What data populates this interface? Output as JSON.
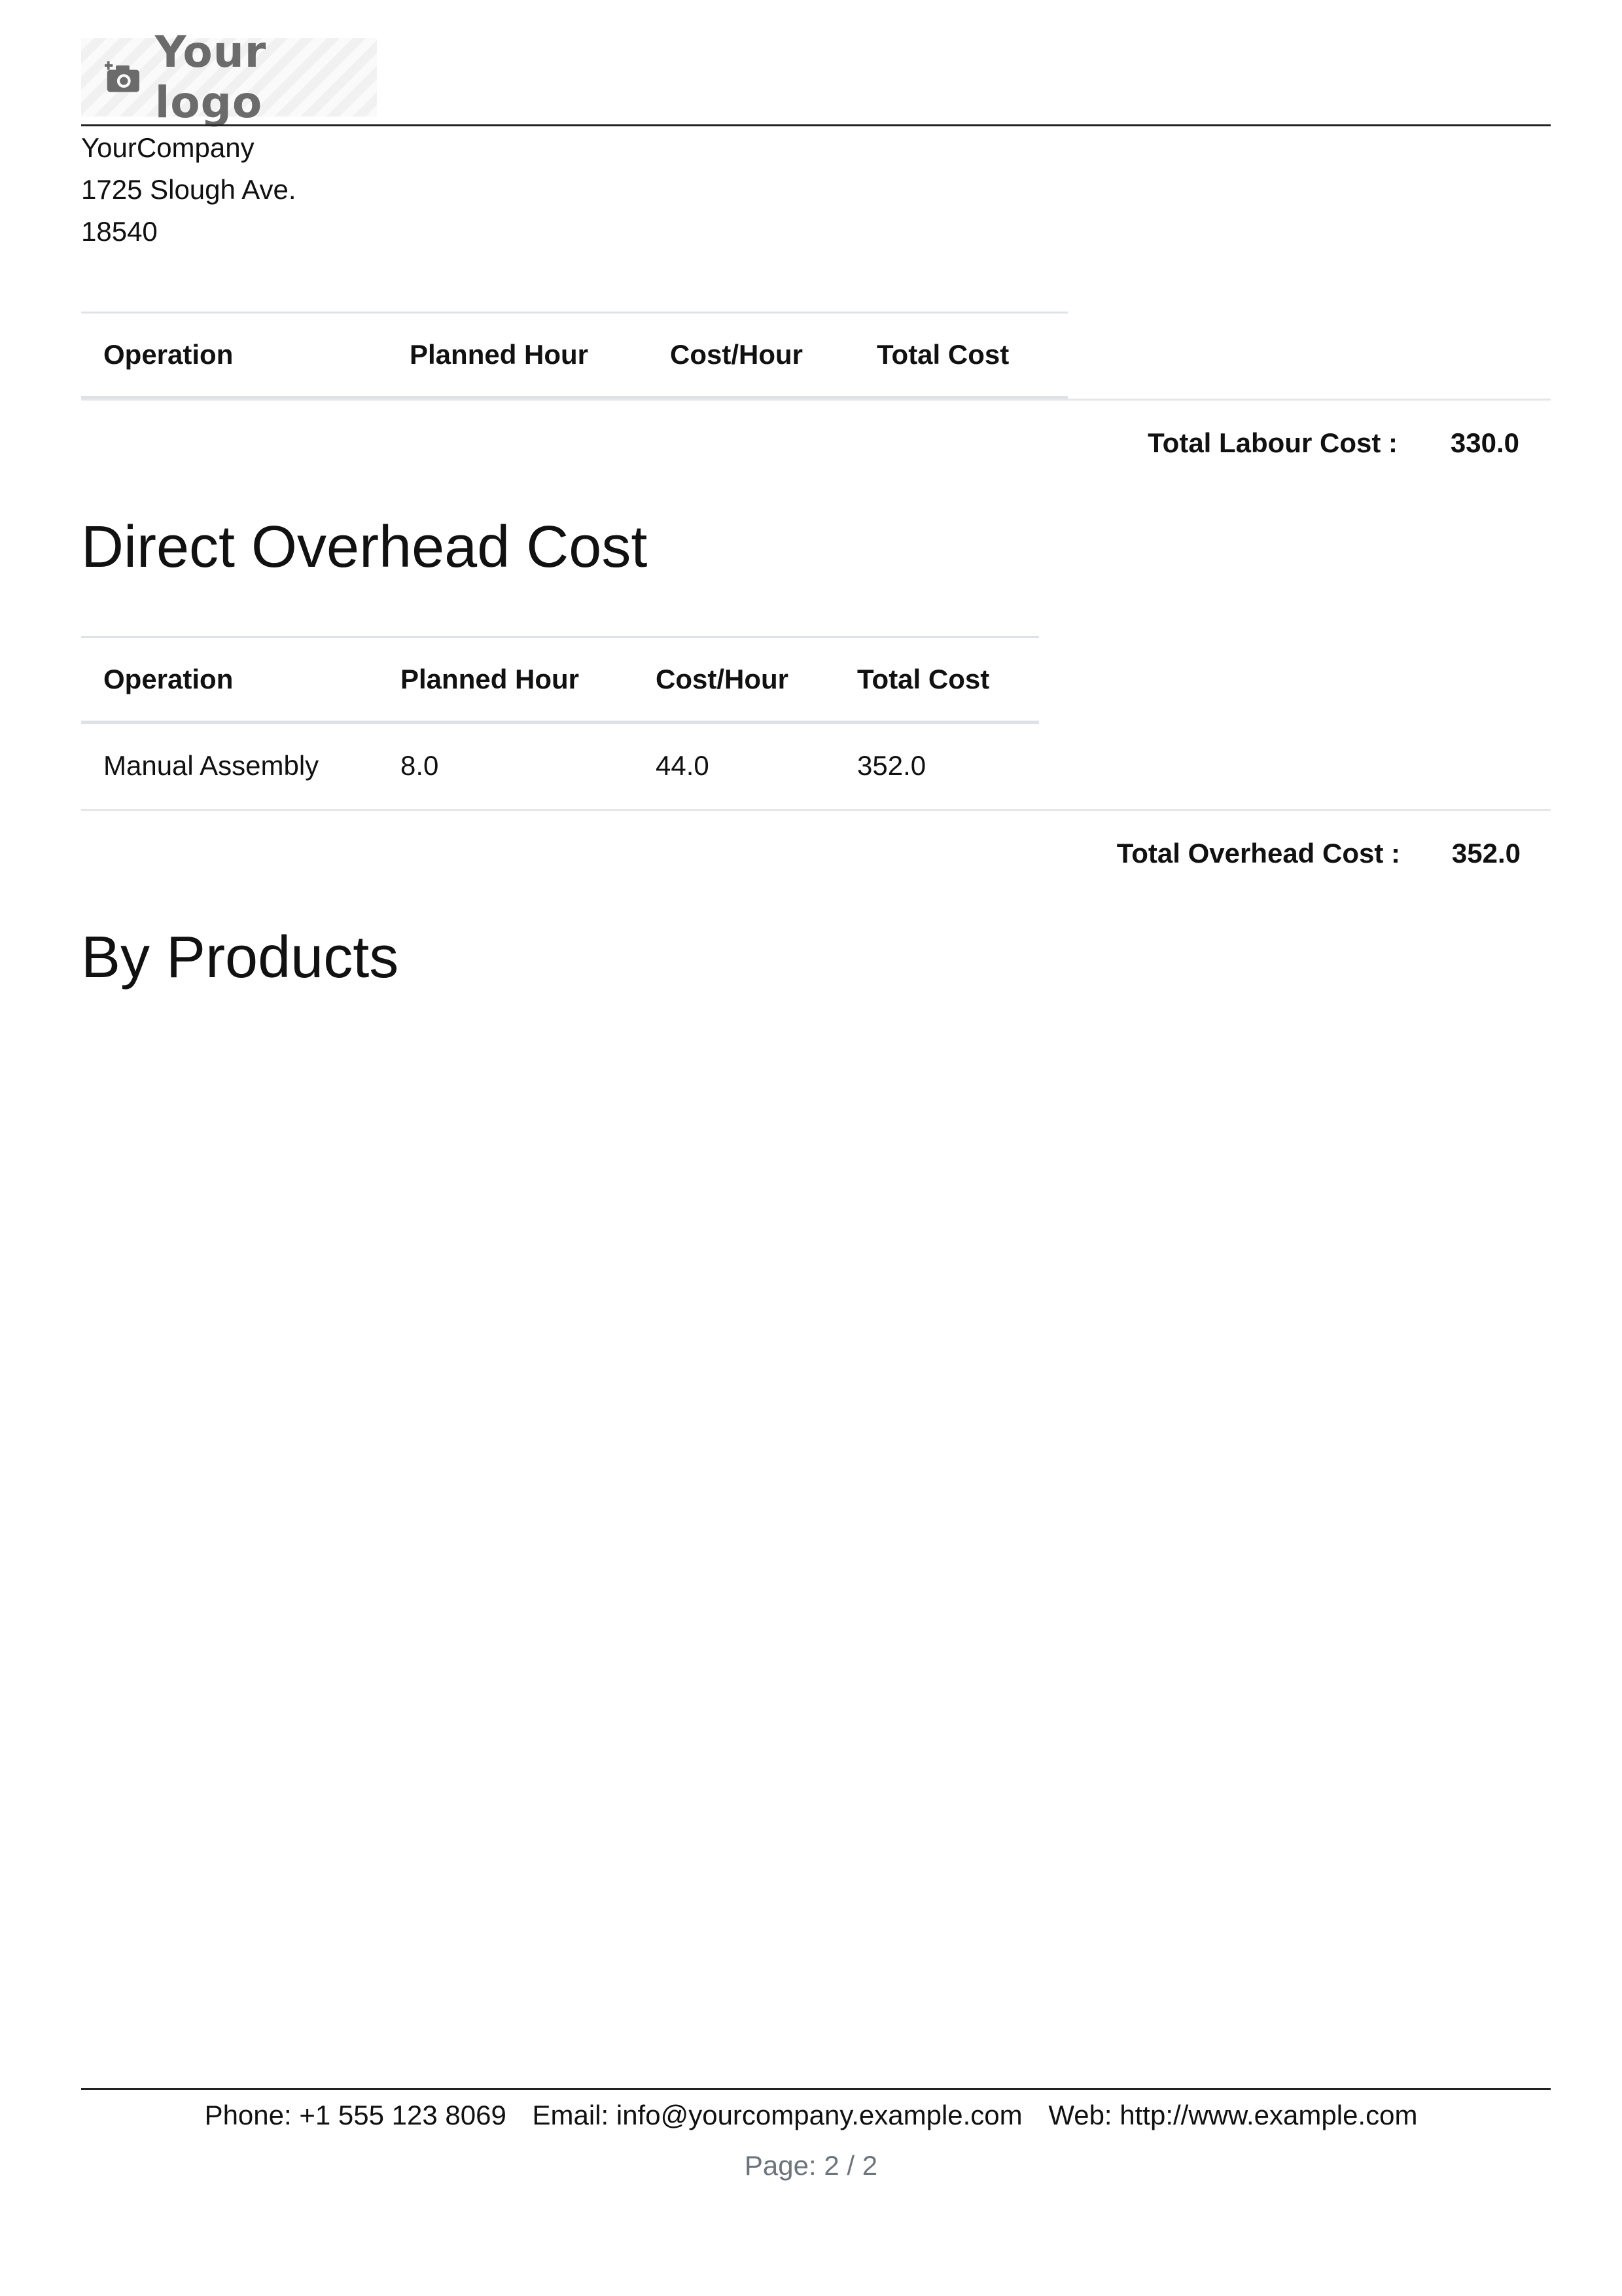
{
  "logo": {
    "text": "Your logo",
    "icon": "camera-icon"
  },
  "company": {
    "name": "YourCompany",
    "street": "1725 Slough Ave.",
    "zip": "18540"
  },
  "labour": {
    "headers": [
      "Operation",
      "Planned Hour",
      "Cost/Hour",
      "Total Cost"
    ],
    "total_label": "Total Labour Cost :",
    "total_value": "330.0"
  },
  "overhead": {
    "title": "Direct Overhead Cost",
    "headers": [
      "Operation",
      "Planned Hour",
      "Cost/Hour",
      "Total Cost"
    ],
    "rows": [
      {
        "operation": "Manual Assembly",
        "planned_hour": "8.0",
        "cost_hour": "44.0",
        "total_cost": "352.0"
      }
    ],
    "total_label": "Total Overhead Cost :",
    "total_value": "352.0"
  },
  "byproducts": {
    "title": "By Products"
  },
  "footer": {
    "phone": "Phone: +1 555 123 8069",
    "email": "Email: info@yourcompany.example.com",
    "web": "Web: http://www.example.com",
    "page": "Page: 2 / 2"
  }
}
